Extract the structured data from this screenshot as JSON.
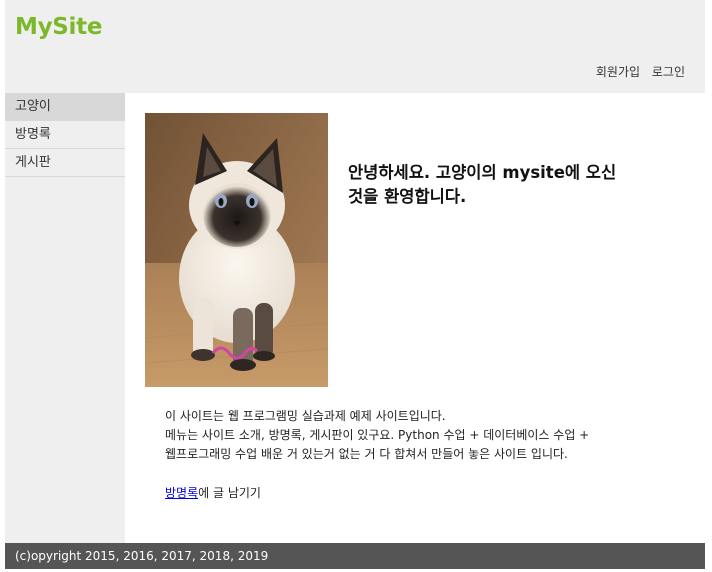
{
  "header": {
    "site_title": "MySite",
    "links": {
      "signup": "회원가입",
      "login": "로그인"
    }
  },
  "sidebar": {
    "items": [
      {
        "label": "고양이"
      },
      {
        "label": "방명록"
      },
      {
        "label": "게시판"
      }
    ],
    "selected_index": 0
  },
  "main": {
    "image_alt": "siamese-kitten-photo",
    "welcome_line1": "안녕하세요. 고양이의 mysite에 오신",
    "welcome_line2": "것을 환영합니다.",
    "intro_lines": [
      "이 사이트는 웹 프로그램밍 실습과제 예제 사이트입니다.",
      "메뉴는 사이트 소개, 방명록, 게시판이 있구요. Python 수업 + 데이터베이스 수업 +",
      "웹프로그래밍 수업 배운 거 있는거 없는 거 다 합쳐서 만들어 놓은 사이트 입니다."
    ],
    "guestbook_link": "방명록",
    "guestbook_suffix": "에 글 남기기"
  },
  "footer": {
    "copyright": "(c)opyright 2015, 2016, 2017, 2018, 2019"
  },
  "colors": {
    "brand": "#7cb82a",
    "header_bg": "#efefef",
    "footer_bg": "#555555",
    "link": "#0000ee"
  }
}
